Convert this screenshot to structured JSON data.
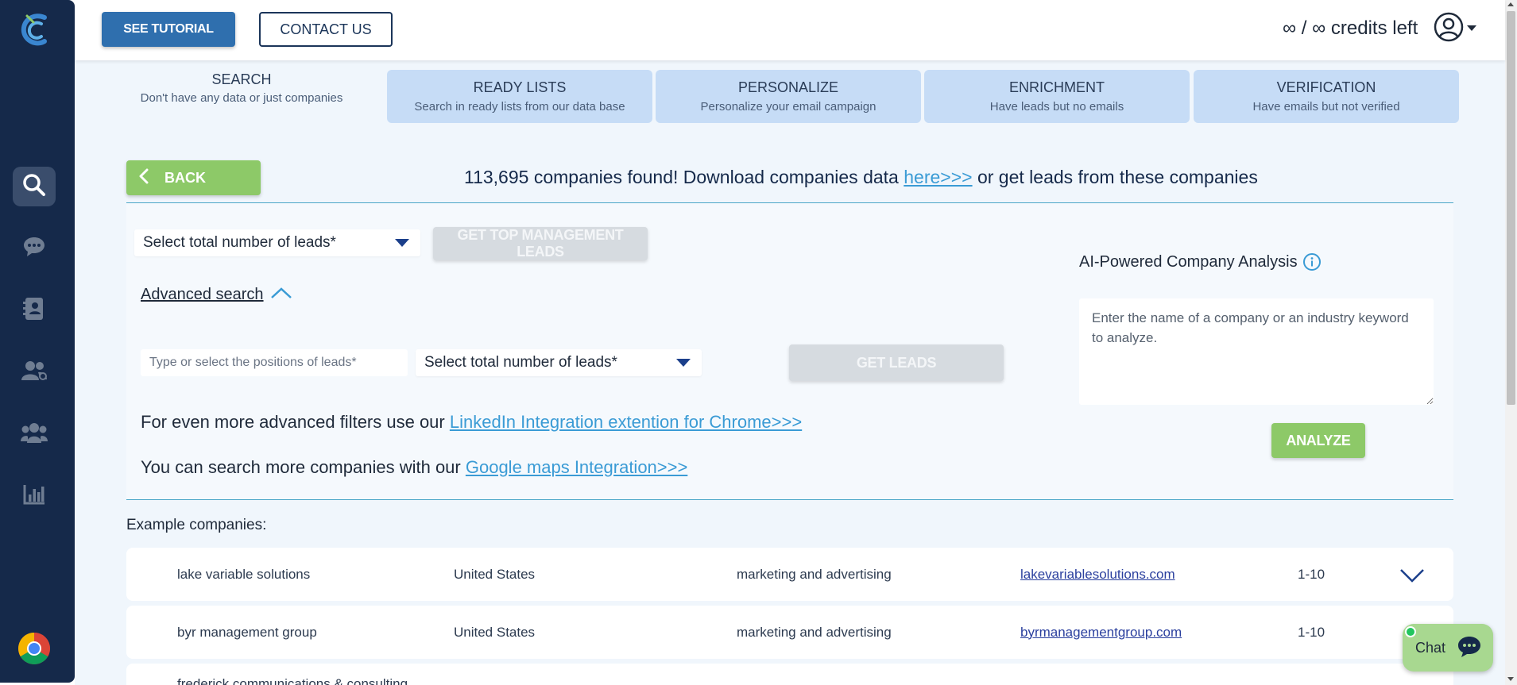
{
  "topbar": {
    "tutorial_label": "SEE TUTORIAL",
    "contact_label": "CONTACT US",
    "credits": "∞ / ∞ credits left"
  },
  "sidebar": {
    "items": [
      {
        "icon": "search-icon",
        "active": true
      },
      {
        "icon": "chat-icon",
        "active": false
      },
      {
        "icon": "contacts-book-icon",
        "active": false
      },
      {
        "icon": "users-group-icon",
        "active": false
      },
      {
        "icon": "team-icon",
        "active": false
      },
      {
        "icon": "analytics-chart-icon",
        "active": false
      }
    ]
  },
  "tabs": [
    {
      "title": "SEARCH",
      "subtitle": "Don't have any data or just companies",
      "active": true
    },
    {
      "title": "READY LISTS",
      "subtitle": "Search in ready lists from our data base"
    },
    {
      "title": "PERSONALIZE",
      "subtitle": "Personalize your email campaign"
    },
    {
      "title": "ENRICHMENT",
      "subtitle": "Have leads but no emails"
    },
    {
      "title": "VERIFICATION",
      "subtitle": "Have emails but not verified"
    }
  ],
  "back_label": "BACK",
  "results": {
    "prefix": "113,695 companies found! Download companies data ",
    "link": "here>>>",
    "suffix": " or get leads from these companies"
  },
  "leads": {
    "select_total": "Select total number of leads*",
    "top_mgmt_button": "GET TOP MANAGEMENT LEADS",
    "advanced_search": "Advanced search",
    "positions_placeholder": "Type or select the positions of leads*",
    "select_total_2": "Select total number of leads*",
    "get_leads_button": "GET LEADS",
    "linkedin_prefix": "For even more advanced filters use our ",
    "linkedin_link": "LinkedIn Integration extention for Chrome>>>",
    "maps_prefix": "You can search more companies with our ",
    "maps_link": "Google maps Integration>>>"
  },
  "ai": {
    "title": "AI-Powered Company Analysis",
    "placeholder": "Enter the name of a company or an industry keyword to analyze.",
    "analyze_button": "ANALYZE"
  },
  "examples": {
    "label": "Example companies:",
    "rows": [
      {
        "name": "lake variable solutions",
        "country": "United States",
        "industry": "marketing and advertising",
        "domain": "lakevariablesolutions.com",
        "size": "1-10"
      },
      {
        "name": "byr management group",
        "country": "United States",
        "industry": "marketing and advertising",
        "domain": "byrmanagementgroup.com",
        "size": "1-10"
      },
      {
        "name": "frederick communications & consulting",
        "country": "",
        "industry": "",
        "domain": "",
        "size": ""
      }
    ]
  },
  "chat": {
    "label": "Chat"
  },
  "colors": {
    "sidebar": "#15294a",
    "primary_blue": "#2f6fae",
    "green": "#8dc968",
    "tab_bg": "#c6dcf6",
    "link": "#3a9bd5"
  }
}
